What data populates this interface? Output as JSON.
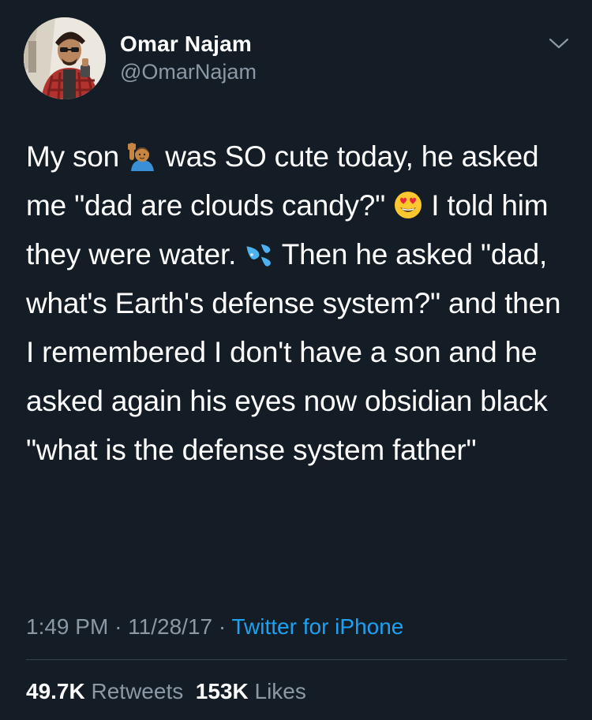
{
  "tweet": {
    "author": {
      "display_name": "Omar Najam",
      "handle": "@OmarNajam",
      "avatar": "profile-photo"
    },
    "menu_icon": "chevron-down-icon",
    "text_segments": [
      {
        "type": "text",
        "value": "My son "
      },
      {
        "type": "emoji",
        "name": "raising-hand-emoji"
      },
      {
        "type": "text",
        "value": " was SO cute today, he asked me \"dad are clouds candy?\" "
      },
      {
        "type": "emoji",
        "name": "heart-eyes-emoji"
      },
      {
        "type": "text",
        "value": " I told him they were water. "
      },
      {
        "type": "emoji",
        "name": "sweat-droplets-emoji"
      },
      {
        "type": "text",
        "value": " Then he asked \"dad, what's Earth's defense system?\" and then I remembered I don't have a son and he asked again his eyes now obsidian black \"what is the defense system father\""
      }
    ],
    "meta": {
      "time": "1:49 PM",
      "separator": "·",
      "date": "11/28/17",
      "source": "Twitter for iPhone"
    },
    "stats": {
      "retweets_count": "49.7K",
      "retweets_label": "Retweets",
      "likes_count": "153K",
      "likes_label": "Likes"
    }
  },
  "colors": {
    "background": "#141d26",
    "text_primary": "#ffffff",
    "text_secondary": "#8b98a5",
    "link": "#1da1f2",
    "divider": "#38444d"
  }
}
